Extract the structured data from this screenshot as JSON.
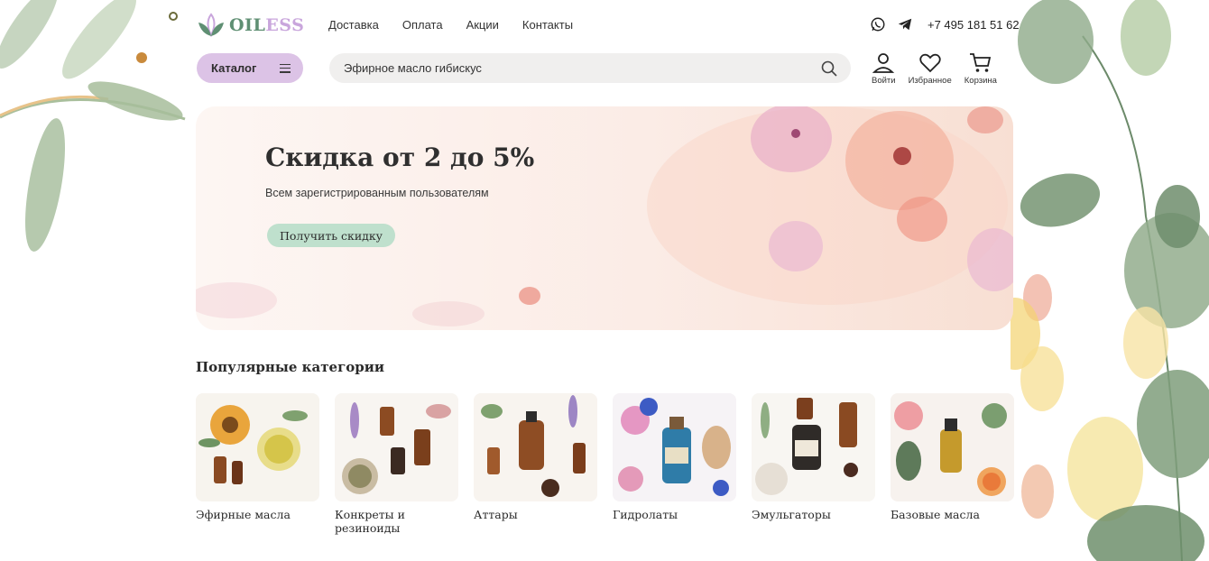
{
  "brand": {
    "logo_part1": "OIL",
    "logo_part2": "ESS",
    "colors": {
      "green": "#5f8f73",
      "lilac": "#c9a6dc",
      "mint": "#bfe0cd"
    }
  },
  "topnav": {
    "items": [
      "Доставка",
      "Оплата",
      "Акции",
      "Контакты"
    ]
  },
  "contacts": {
    "icons": [
      "whatsapp-icon",
      "telegram-icon"
    ],
    "phone": "+7 495 181 51 62"
  },
  "catalog": {
    "label": "Каталог",
    "icon": "menu-icon"
  },
  "search": {
    "value": "Эфирное масло гибискус",
    "icon": "search-icon"
  },
  "user_actions": {
    "login": "Войти",
    "favorites": "Избранное",
    "cart": "Корзина"
  },
  "hero": {
    "title": "Скидка от 2 до 5%",
    "subtitle": "Всем зарегистрированным пользователям",
    "button": "Получить скидку"
  },
  "categories": {
    "title": "Популярные категории",
    "items": [
      {
        "label": "Эфирные масла"
      },
      {
        "label": "Конкреты и резиноиды"
      },
      {
        "label": "Аттары"
      },
      {
        "label": "Гидролаты"
      },
      {
        "label": "Эмульгаторы"
      },
      {
        "label": "Базовые масла"
      }
    ]
  }
}
